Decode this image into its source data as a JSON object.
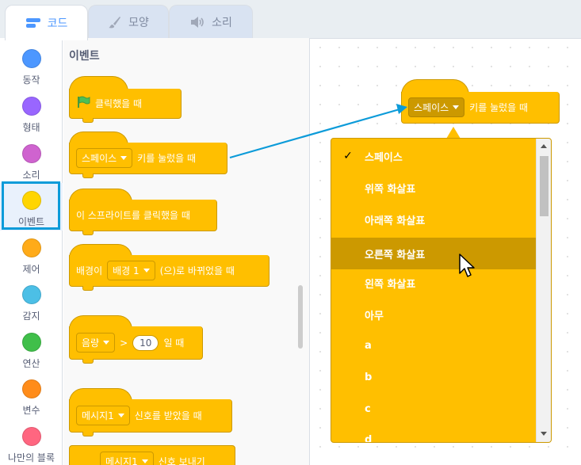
{
  "tabs": [
    {
      "label": "코드",
      "icon": "code-icon"
    },
    {
      "label": "모양",
      "icon": "brush-icon"
    },
    {
      "label": "소리",
      "icon": "speaker-icon"
    }
  ],
  "categories": [
    {
      "label": "동작",
      "color": "#4c97ff"
    },
    {
      "label": "형태",
      "color": "#9966ff"
    },
    {
      "label": "소리",
      "color": "#cf63cf"
    },
    {
      "label": "이벤트",
      "color": "#ffd500"
    },
    {
      "label": "제어",
      "color": "#ffab19"
    },
    {
      "label": "감지",
      "color": "#4cbfe6"
    },
    {
      "label": "연산",
      "color": "#40bf4a"
    },
    {
      "label": "변수",
      "color": "#ff8c1a"
    },
    {
      "label": "나만의 블록",
      "color": "#ff6680"
    }
  ],
  "palette": {
    "title": "이벤트",
    "flag_block": {
      "text": "클릭했을 때",
      "icon": "green-flag-icon"
    },
    "key_block": {
      "key": "스페이스",
      "text": "키를 눌렀을 때"
    },
    "sprite_block": {
      "text": "이 스프라이트를 클릭했을 때"
    },
    "backdrop_block": {
      "pre": "배경이",
      "value": "배경 1",
      "post": "(으)로 바뀌었을 때"
    },
    "loud_block": {
      "value": "음량",
      "op": ">",
      "num": "10",
      "post": "일 때"
    },
    "receive_block": {
      "value": "메시지1",
      "post": "신호를 받았을 때"
    },
    "broadcast_block": {
      "value": "메시지1",
      "post": "신호 보내기"
    }
  },
  "workspace_block": {
    "key": "스페이스",
    "text": "키를 눌렀을 때"
  },
  "dropdown": {
    "selected_index": 0,
    "highlighted_index": 3,
    "items": [
      "스페이스",
      "위쪽 화살표",
      "아래쪽 화살표",
      "오른쪽 화살표",
      "왼쪽 화살표",
      "아무",
      "a",
      "b",
      "c",
      "d"
    ]
  },
  "colors": {
    "events": "#ffbf00",
    "events_dark": "#cc9900",
    "accent": "#4c97ff",
    "selection": "#0c9bd9"
  }
}
